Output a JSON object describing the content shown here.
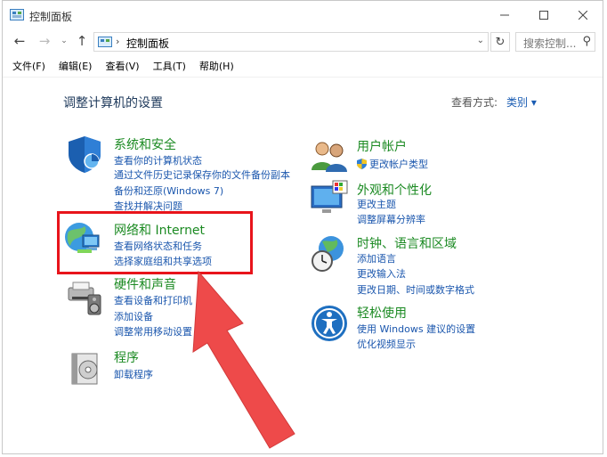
{
  "window": {
    "title": "控制面板"
  },
  "nav": {
    "address_path": "控制面板",
    "search_placeholder": "搜索控制..."
  },
  "menu": [
    "文件(F)",
    "编辑(E)",
    "查看(V)",
    "工具(T)",
    "帮助(H)"
  ],
  "heading": "调整计算机的设置",
  "view_by": {
    "label": "查看方式:",
    "value": "类别 ▾"
  },
  "categories": {
    "system_security": {
      "title": "系统和安全",
      "links": [
        "查看你的计算机状态",
        "通过文件历史记录保存你的文件备份副本",
        "备份和还原(Windows 7)",
        "查找并解决问题"
      ]
    },
    "network": {
      "title": "网络和 Internet",
      "links": [
        "查看网络状态和任务",
        "选择家庭组和共享选项"
      ]
    },
    "hardware": {
      "title": "硬件和声音",
      "links": [
        "查看设备和打印机",
        "添加设备",
        "调整常用移动设置"
      ]
    },
    "programs": {
      "title": "程序",
      "links": [
        "卸载程序"
      ]
    },
    "user_accounts": {
      "title": "用户帐户",
      "links": [
        "更改帐户类型"
      ]
    },
    "appearance": {
      "title": "外观和个性化",
      "links": [
        "更改主题",
        "调整屏幕分辨率"
      ]
    },
    "clock_region": {
      "title": "时钟、语言和区域",
      "links": [
        "添加语言",
        "更改输入法",
        "更改日期、时间或数字格式"
      ]
    },
    "ease_access": {
      "title": "轻松使用",
      "links": [
        "使用 Windows 建议的设置",
        "优化视频显示"
      ]
    }
  },
  "colors": {
    "category_title": "#1b8a22",
    "link": "#1a56ad",
    "highlight": "#e8141b",
    "arrow": "#ee4a4a"
  }
}
